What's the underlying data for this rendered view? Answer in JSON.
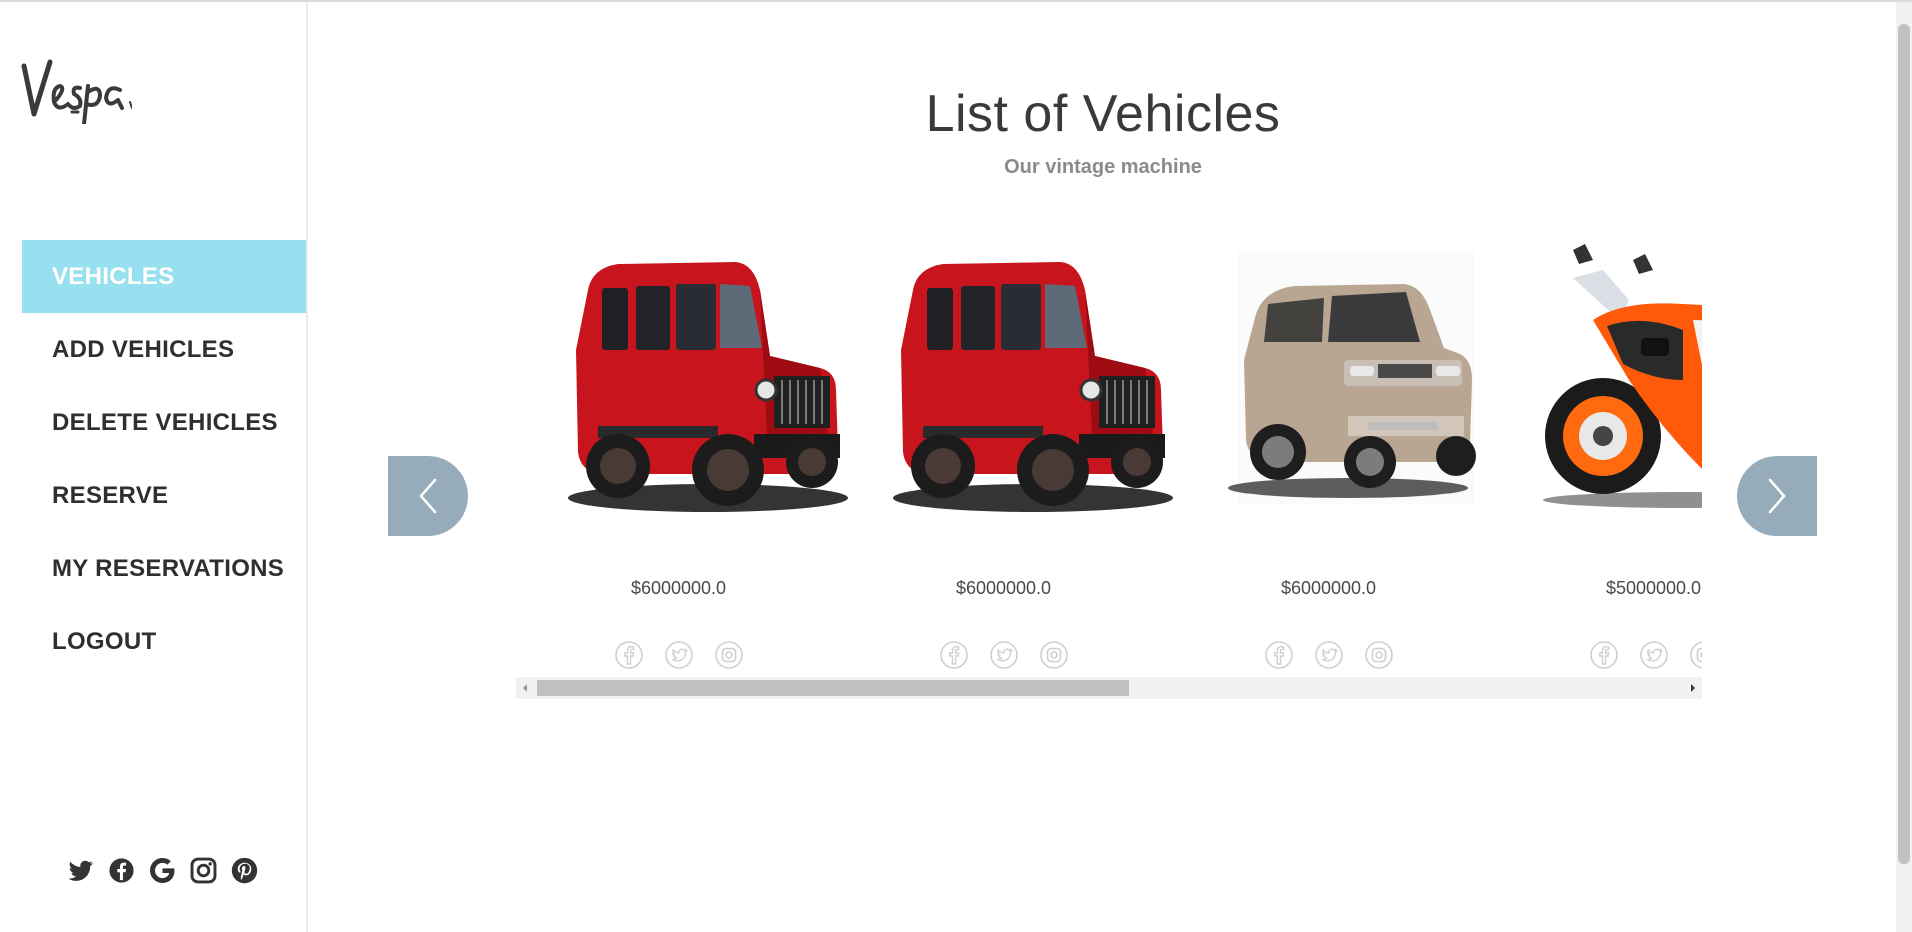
{
  "brand": {
    "logo_text": "Vespa"
  },
  "sidebar": {
    "items": [
      {
        "label": "VEHICLES",
        "active": true
      },
      {
        "label": "ADD VEHICLES",
        "active": false
      },
      {
        "label": "DELETE VEHICLES",
        "active": false
      },
      {
        "label": "RESERVE",
        "active": false
      },
      {
        "label": "MY RESERVATIONS",
        "active": false
      },
      {
        "label": "LOGOUT",
        "active": false
      }
    ],
    "social_icons": [
      "twitter-icon",
      "facebook-icon",
      "google-icon",
      "instagram-icon",
      "pinterest-icon"
    ]
  },
  "main": {
    "title": "List of Vehicles",
    "subtitle": "Our vintage machine",
    "vehicles": [
      {
        "price": "$6000000.0",
        "image": "red-suv"
      },
      {
        "price": "$6000000.0",
        "image": "red-suv"
      },
      {
        "price": "$6000000.0",
        "image": "champagne-suv"
      },
      {
        "price": "$5000000.0",
        "image": "orange-motorcycle"
      }
    ],
    "card_icons": [
      "facebook-icon",
      "twitter-icon",
      "instagram-icon"
    ],
    "carousel_scroll_fraction": 0.5
  },
  "colors": {
    "active_nav": "#97e0ef",
    "arrow_bg": "#96acbb",
    "text": "#3a3a3a",
    "muted": "#8b8b8b"
  }
}
